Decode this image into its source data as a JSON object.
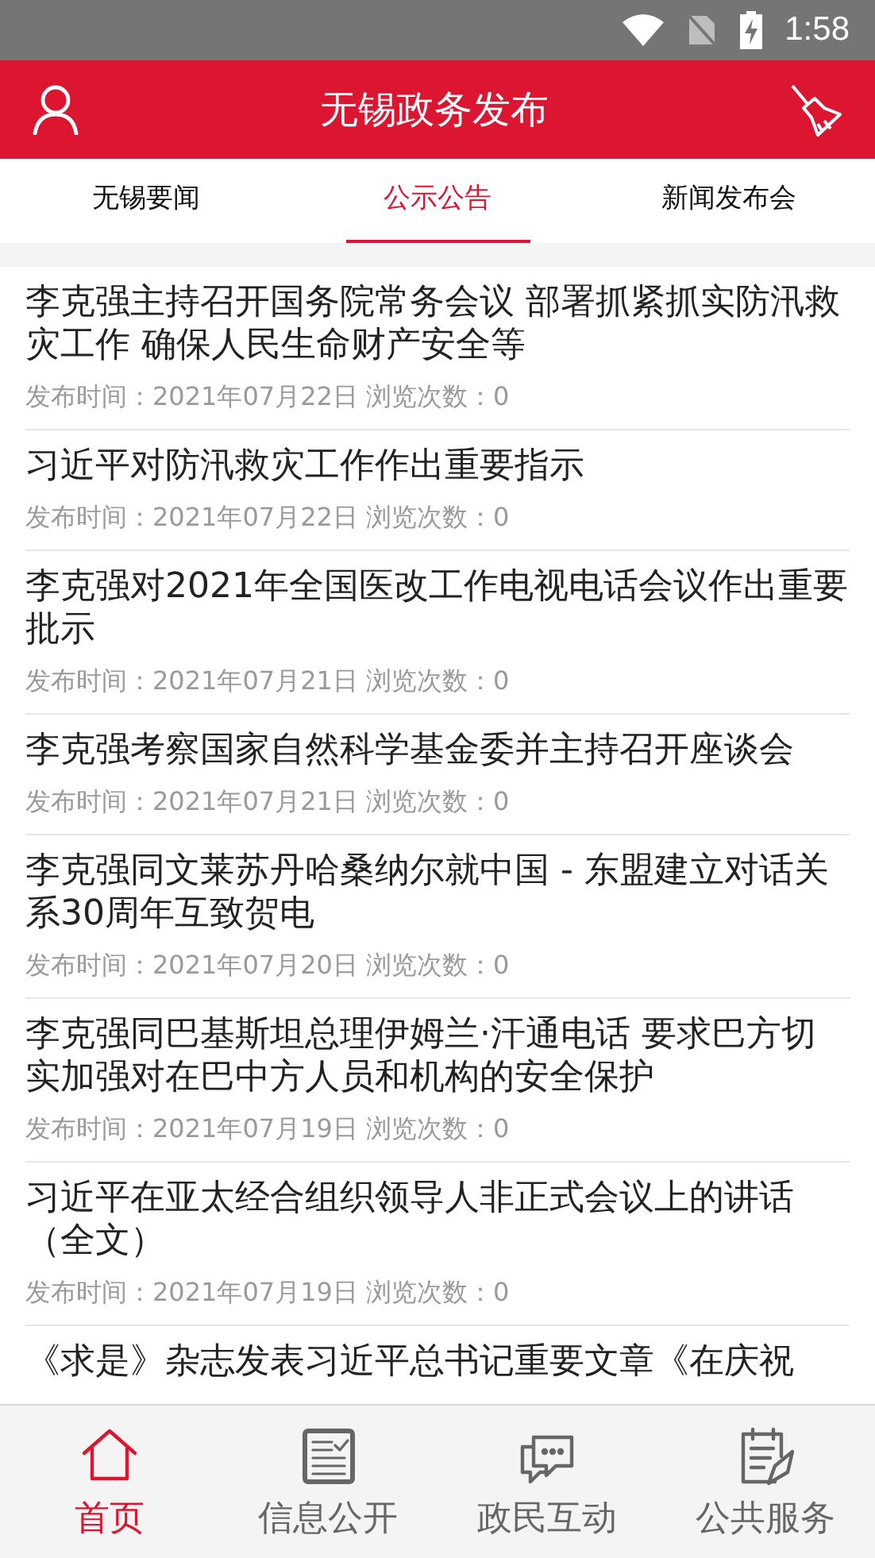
{
  "status_bar": {
    "time": "1:58"
  },
  "header": {
    "title": "无锡政务发布"
  },
  "tabs": [
    {
      "label": "无锡要闻",
      "selected": false
    },
    {
      "label": "公示公告",
      "selected": true
    },
    {
      "label": "新闻发布会",
      "selected": false
    }
  ],
  "articles": [
    {
      "title": "李克强主持召开国务院常务会议 部署抓紧抓实防汛救灾工作 确保人民生命财产安全等",
      "meta": "发布时间：2021年07月22日 浏览次数：0"
    },
    {
      "title": "习近平对防汛救灾工作作出重要指示",
      "meta": "发布时间：2021年07月22日 浏览次数：0"
    },
    {
      "title": "李克强对2021年全国医改工作电视电话会议作出重要批示",
      "meta": "发布时间：2021年07月21日 浏览次数：0"
    },
    {
      "title": "李克强考察国家自然科学基金委并主持召开座谈会",
      "meta": "发布时间：2021年07月21日 浏览次数：0"
    },
    {
      "title": "李克强同文莱苏丹哈桑纳尔就中国 - 东盟建立对话关系30周年互致贺电",
      "meta": "发布时间：2021年07月20日 浏览次数：0"
    },
    {
      "title": "李克强同巴基斯坦总理伊姆兰·汗通电话 要求巴方切实加强对在巴中方人员和机构的安全保护",
      "meta": "发布时间：2021年07月19日 浏览次数：0"
    },
    {
      "title": "习近平在亚太经合组织领导人非正式会议上的讲话（全文）",
      "meta": "发布时间：2021年07月19日 浏览次数：0"
    },
    {
      "title": "《求是》杂志发表习近平总书记重要文章《在庆祝"
    }
  ],
  "bottom_nav": [
    {
      "label": "首页",
      "kind": "home",
      "selected": true
    },
    {
      "label": "信息公开",
      "kind": "document",
      "selected": false
    },
    {
      "label": "政民互动",
      "kind": "chat",
      "selected": false
    },
    {
      "label": "公共服务",
      "kind": "clipboard",
      "selected": false
    }
  ]
}
